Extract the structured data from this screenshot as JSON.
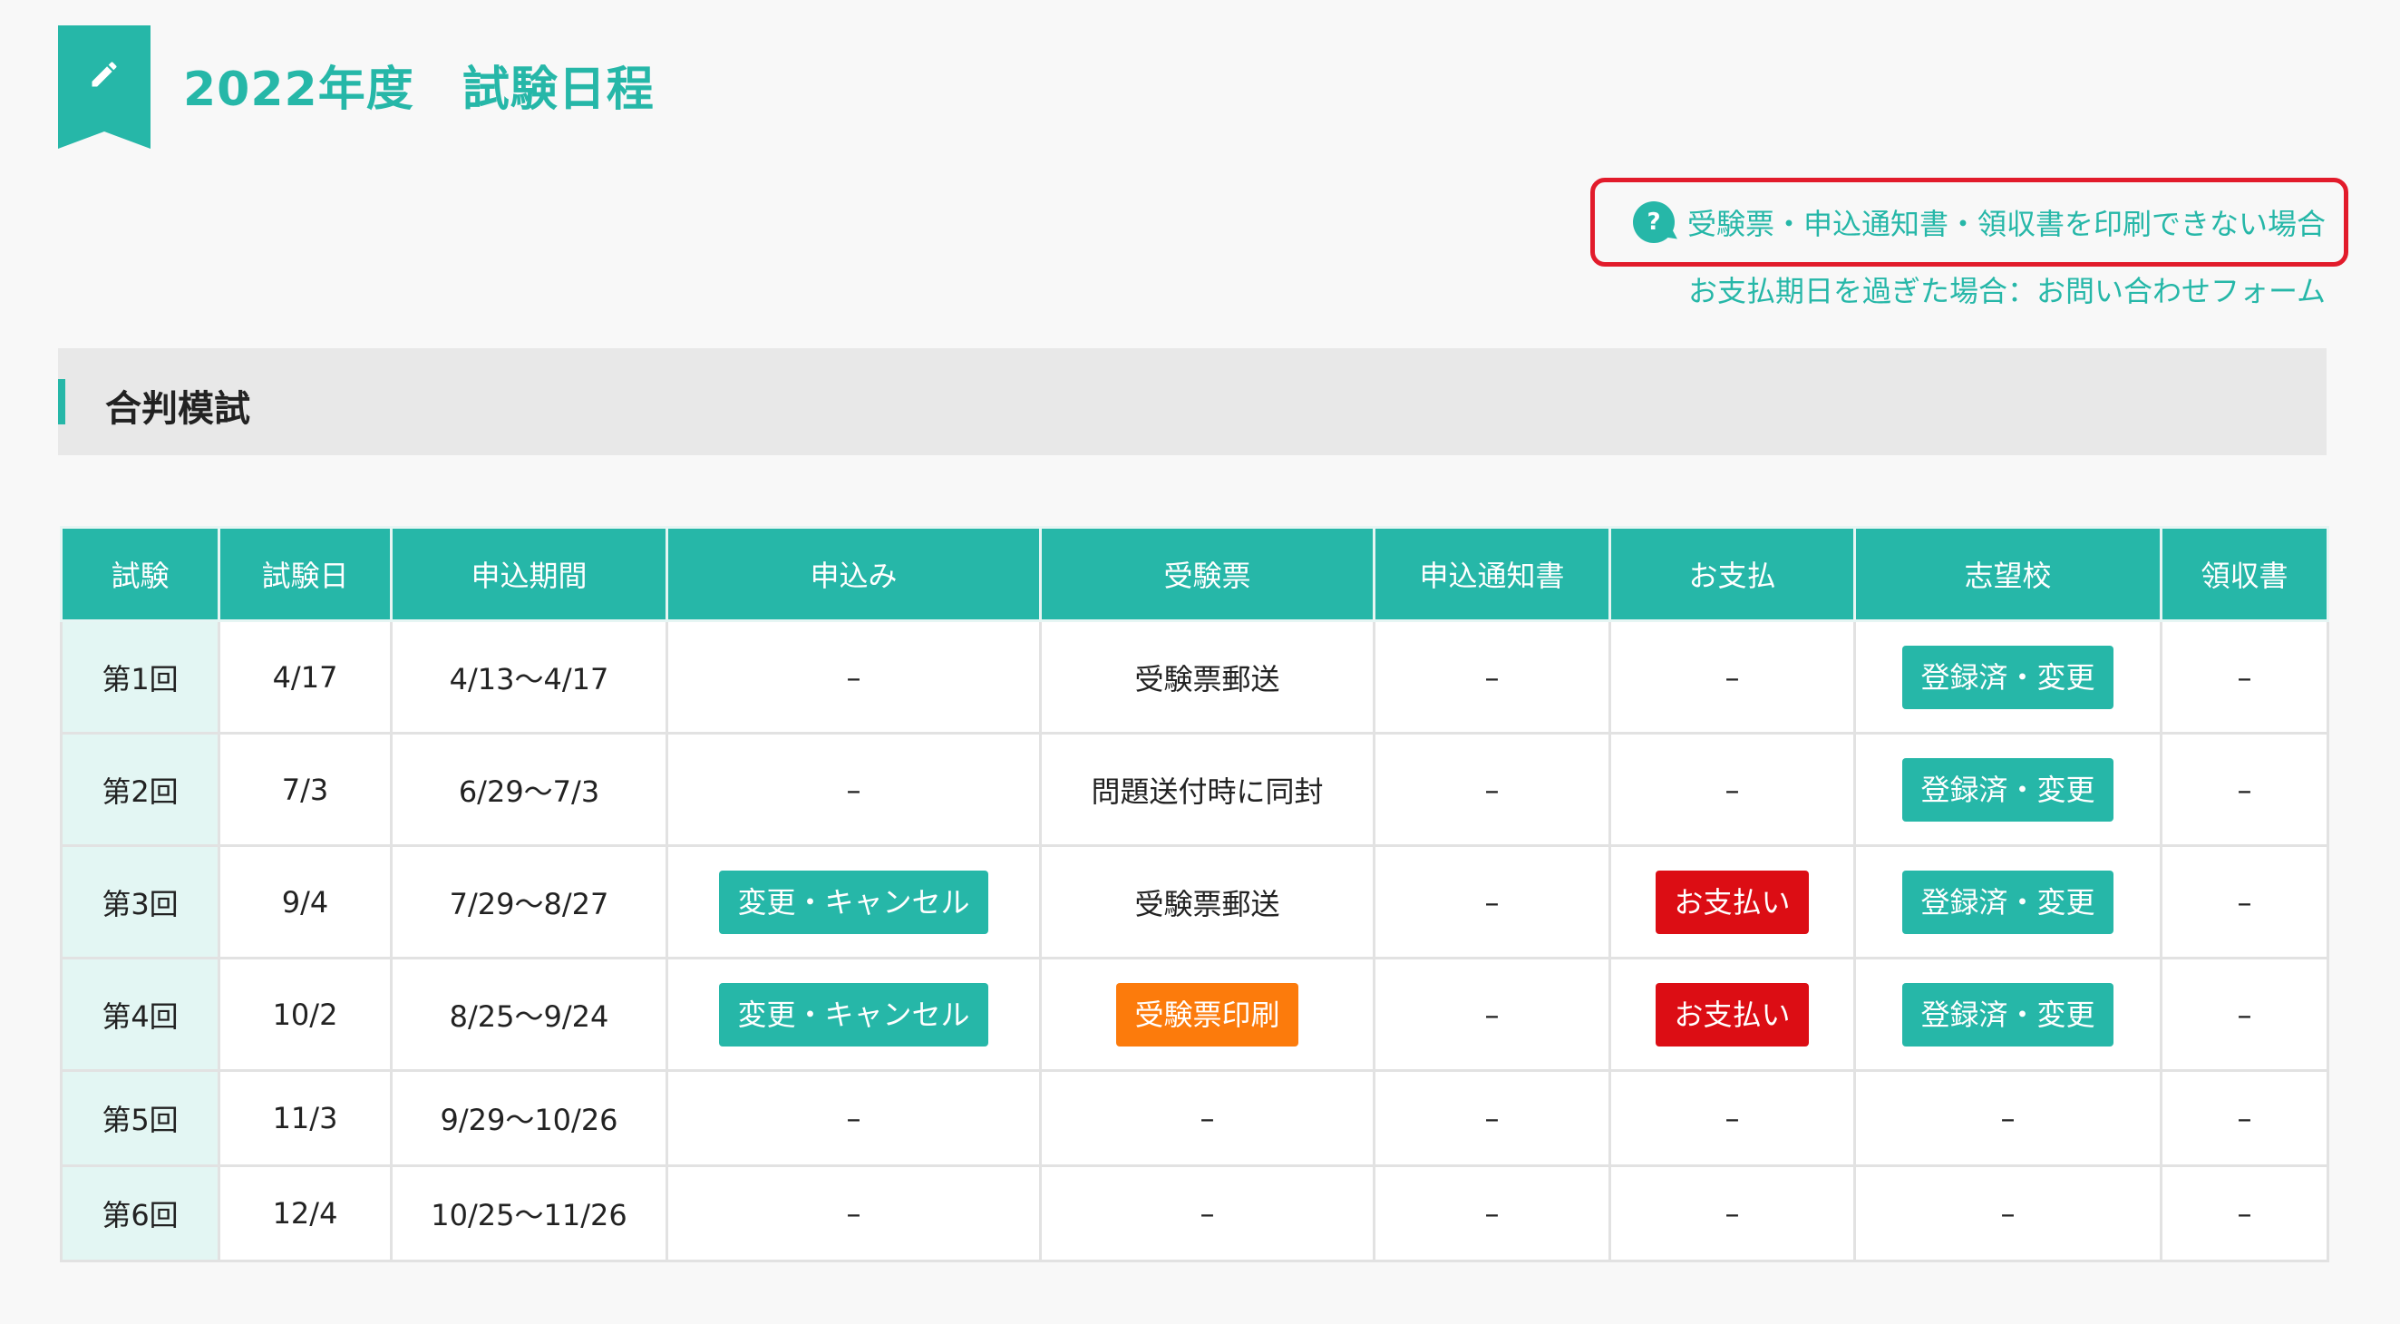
{
  "header": {
    "title": "2022年度　試験日程",
    "icon": "pencil-icon",
    "accent_color": "#26b7a8"
  },
  "help_links": {
    "print_help": "受験票・申込通知書・領収書を印刷できない場合",
    "payment_form": "お支払期日を過ぎた場合：お問い合わせフォーム",
    "highlight_color": "#e21b2b"
  },
  "section": {
    "title": "合判模試"
  },
  "table": {
    "headers": [
      "試験",
      "試験日",
      "申込期間",
      "申込み",
      "受験票",
      "申込通知書",
      "お支払",
      "志望校",
      "領収書"
    ],
    "rows": [
      {
        "round": "第1回",
        "date": "4/17",
        "period": "4/13〜4/17",
        "apply": {
          "type": "text",
          "label": "–"
        },
        "ticket": {
          "type": "text",
          "label": "受験票郵送"
        },
        "notice": {
          "type": "text",
          "label": "–"
        },
        "payment": {
          "type": "text",
          "label": "–"
        },
        "school": {
          "type": "button",
          "label": "登録済・変更",
          "color": "teal"
        },
        "receipt": {
          "type": "text",
          "label": "–"
        }
      },
      {
        "round": "第2回",
        "date": "7/3",
        "period": "6/29〜7/3",
        "apply": {
          "type": "text",
          "label": "–"
        },
        "ticket": {
          "type": "text",
          "label": "問題送付時に同封"
        },
        "notice": {
          "type": "text",
          "label": "–"
        },
        "payment": {
          "type": "text",
          "label": "–"
        },
        "school": {
          "type": "button",
          "label": "登録済・変更",
          "color": "teal"
        },
        "receipt": {
          "type": "text",
          "label": "–"
        }
      },
      {
        "round": "第3回",
        "date": "9/4",
        "period": "7/29〜8/27",
        "apply": {
          "type": "button",
          "label": "変更・キャンセル",
          "color": "teal"
        },
        "ticket": {
          "type": "text",
          "label": "受験票郵送"
        },
        "notice": {
          "type": "text",
          "label": "–"
        },
        "payment": {
          "type": "button",
          "label": "お支払い",
          "color": "red"
        },
        "school": {
          "type": "button",
          "label": "登録済・変更",
          "color": "teal"
        },
        "receipt": {
          "type": "text",
          "label": "–"
        }
      },
      {
        "round": "第4回",
        "date": "10/2",
        "period": "8/25〜9/24",
        "apply": {
          "type": "button",
          "label": "変更・キャンセル",
          "color": "teal"
        },
        "ticket": {
          "type": "button",
          "label": "受験票印刷",
          "color": "orange"
        },
        "notice": {
          "type": "text",
          "label": "–"
        },
        "payment": {
          "type": "button",
          "label": "お支払い",
          "color": "red"
        },
        "school": {
          "type": "button",
          "label": "登録済・変更",
          "color": "teal"
        },
        "receipt": {
          "type": "text",
          "label": "–"
        }
      },
      {
        "round": "第5回",
        "date": "11/3",
        "period": "9/29〜10/26",
        "apply": {
          "type": "text",
          "label": "–"
        },
        "ticket": {
          "type": "text",
          "label": "–"
        },
        "notice": {
          "type": "text",
          "label": "–"
        },
        "payment": {
          "type": "text",
          "label": "–"
        },
        "school": {
          "type": "text",
          "label": "–"
        },
        "receipt": {
          "type": "text",
          "label": "–"
        }
      },
      {
        "round": "第6回",
        "date": "12/4",
        "period": "10/25〜11/26",
        "apply": {
          "type": "text",
          "label": "–"
        },
        "ticket": {
          "type": "text",
          "label": "–"
        },
        "notice": {
          "type": "text",
          "label": "–"
        },
        "payment": {
          "type": "text",
          "label": "–"
        },
        "school": {
          "type": "text",
          "label": "–"
        },
        "receipt": {
          "type": "text",
          "label": "–"
        }
      }
    ]
  }
}
